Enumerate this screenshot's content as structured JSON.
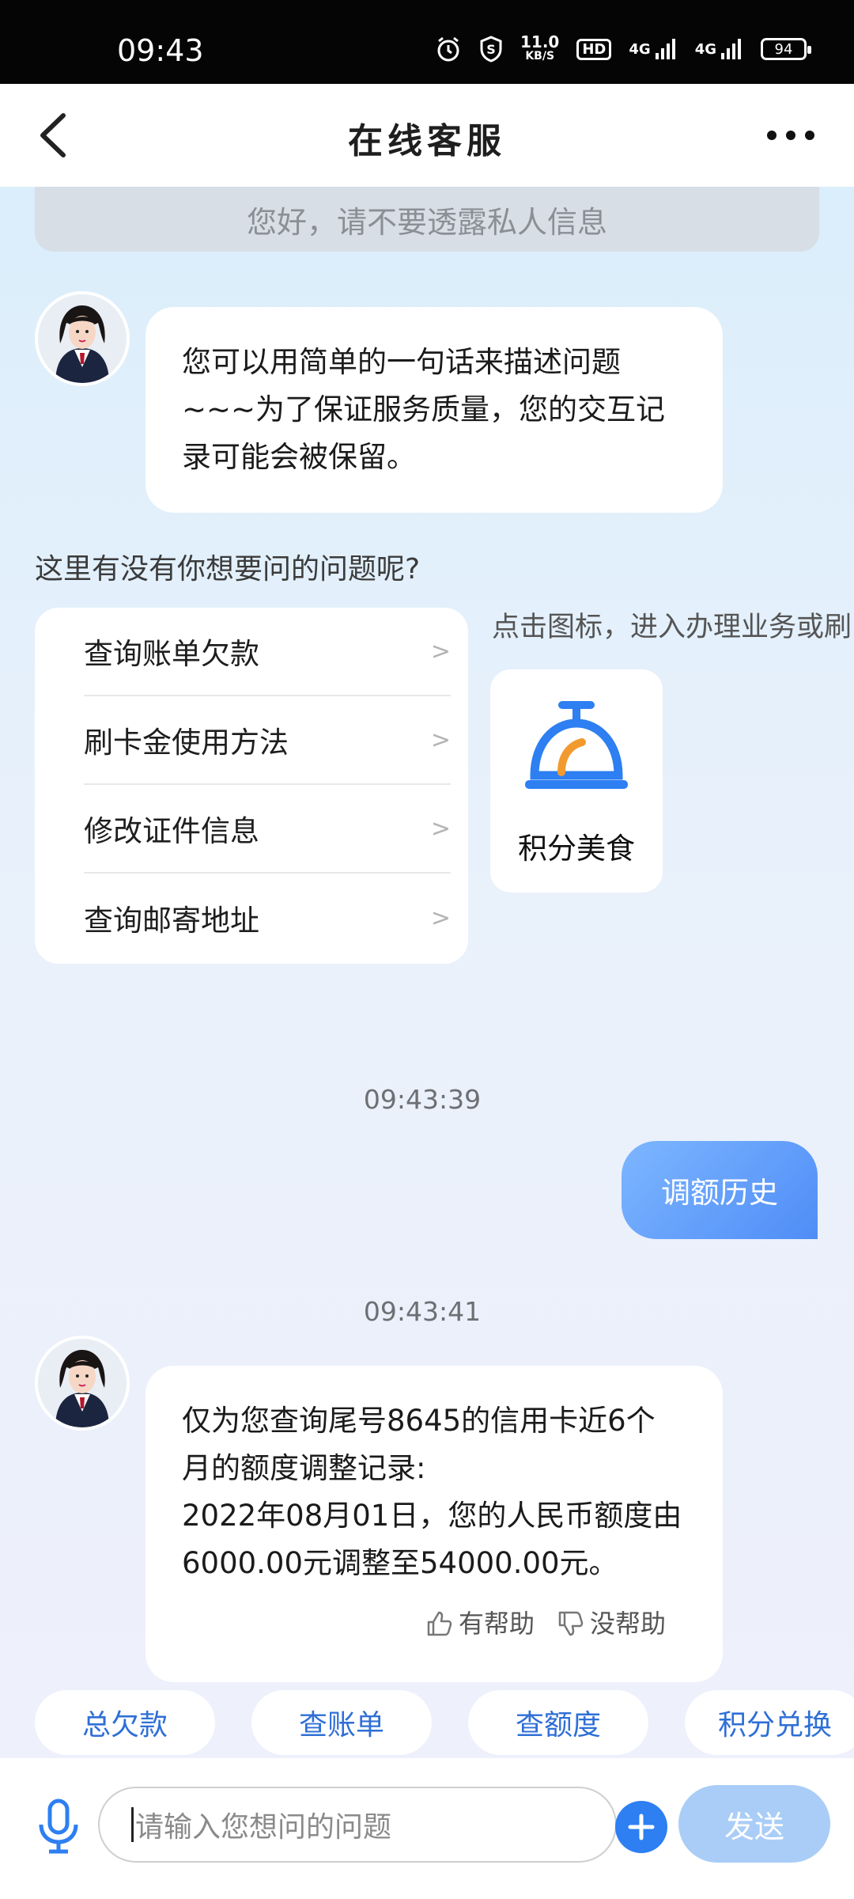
{
  "status_bar": {
    "time": "09:43",
    "speed_value": "11.0",
    "speed_unit": "KB/S",
    "hd_label": "HD",
    "signal1": "4G",
    "signal2": "4G",
    "battery": "94"
  },
  "header": {
    "title": "在线客服"
  },
  "chat": {
    "notice": "您好，请不要透露私人信息",
    "welcome_message": {
      "line1": "您可以用简单的一句话来描述问题",
      "line2": "~~~为了保证服务质量，您的交互记",
      "line3": "录可能会被保留。"
    },
    "faq_prompt": "这里有没有你想要问的问题呢?",
    "faq_items": [
      {
        "label": "查询账单欠款"
      },
      {
        "label": "刷卡金使用方法"
      },
      {
        "label": "修改证件信息"
      },
      {
        "label": "查询邮寄地址"
      }
    ],
    "faq_chevron": ">",
    "service_hint": "点击图标，进入办理业务或刷",
    "service": {
      "label": "积分美食",
      "icon": "service-bell-icon"
    },
    "time1": "09:43:39",
    "user_message": "调额历史",
    "time2": "09:43:41",
    "reply_message": {
      "line1": "仅为您查询尾号8645的信用卡近6个",
      "line2": "月的额度调整记录:",
      "line3": "2022年08月01日，您的人民币额度由",
      "line4": "6000.00元调整至54000.00元。"
    },
    "helpful_label": "有帮助",
    "not_helpful_label": "没帮助"
  },
  "quick_actions": [
    {
      "label": "总欠款"
    },
    {
      "label": "查账单"
    },
    {
      "label": "查额度"
    },
    {
      "label": "积分兑换"
    }
  ],
  "input_bar": {
    "placeholder": "请输入您想问的问题",
    "send_label": "发送"
  },
  "colors": {
    "accent": "#2d7ff2",
    "user_bubble": "#5f9bf9",
    "send_disabled": "#a9cdf7"
  }
}
